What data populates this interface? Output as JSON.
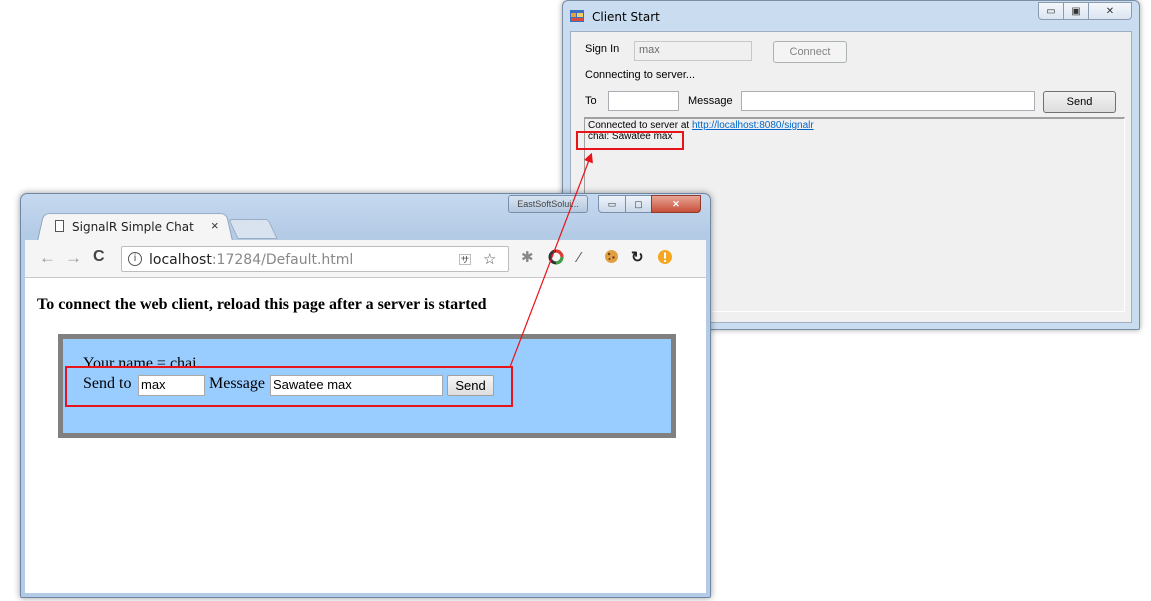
{
  "client_window": {
    "title": "Client Start",
    "caption_buttons": {
      "minimize": "▭",
      "maximize": "▣",
      "close": "✕"
    },
    "sign_in_label": "Sign In",
    "sign_in_value": "max",
    "connect_label": "Connect",
    "status": "Connecting to server...",
    "to_label": "To",
    "to_value": "",
    "message_label": "Message",
    "message_value": "",
    "send_label": "Send",
    "log": {
      "connected_prefix": "Connected to server at ",
      "connected_link": "http://localhost:8080/signalr",
      "message_line": "chai: Sawatee max"
    }
  },
  "browser": {
    "profile_label": "EastSoftSolui...",
    "tab_title": "SignalR Simple Chat",
    "tab_close": "×",
    "nav": {
      "back": "←",
      "forward": "→",
      "reload": "C"
    },
    "url_host": "localhost",
    "url_path": ":17284/Default.html",
    "icons": {
      "translate": "🈂",
      "star": "☆"
    },
    "page": {
      "heading": "To connect the web client, reload this page after a server is started",
      "your_name": "Your name = chai",
      "send_to_label": "Send to",
      "send_to_value": "max",
      "message_label": "Message",
      "message_value": "Sawatee max",
      "send_label": "Send"
    }
  },
  "colors": {
    "annotation": "#e8141b",
    "chat_panel_bg": "#99ccff",
    "chat_panel_border": "#808080",
    "link": "#0066cc"
  }
}
